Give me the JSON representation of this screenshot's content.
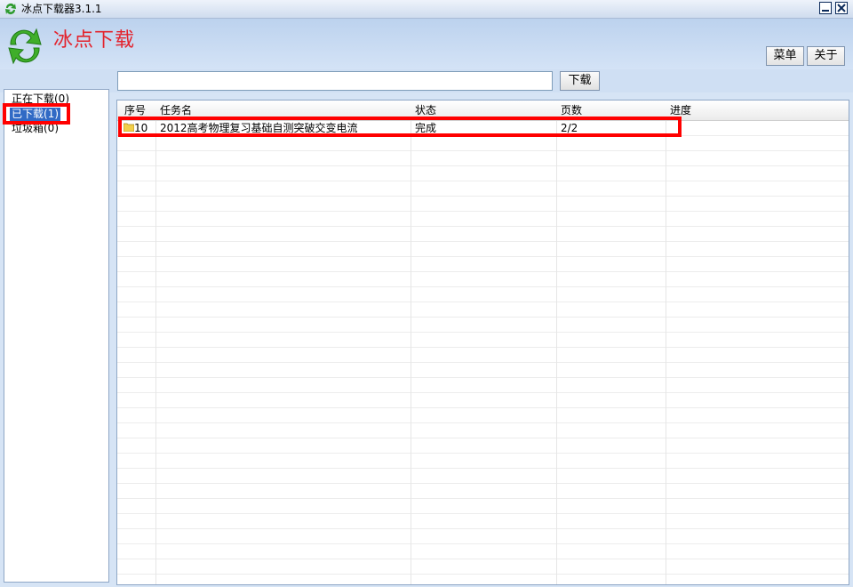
{
  "window": {
    "title": "冰点下载器3.1.1",
    "app_icon": "refresh-arrows-icon",
    "buttons": [
      "minimize-icon",
      "close-icon"
    ]
  },
  "header": {
    "brand": "冰点下载",
    "brand_color": "#e3232d",
    "logo_icon": "green-refresh-arrows-icon",
    "menu_label": "菜单",
    "about_label": "关于"
  },
  "toolbar": {
    "url_value": "",
    "download_label": "下载"
  },
  "sidebar": {
    "items": [
      {
        "label": "正在下载(0)",
        "selected": false
      },
      {
        "label": "已下载(1)",
        "selected": true
      },
      {
        "label": "垃圾箱(0)",
        "selected": false
      }
    ]
  },
  "table": {
    "columns": [
      "序号",
      "任务名",
      "状态",
      "页数",
      "进度"
    ],
    "rows": [
      {
        "seq": "10",
        "name": "2012高考物理复习基础自测突破交变电流",
        "status": "完成",
        "pages": "2/2",
        "progress": "",
        "icon": "folder-icon"
      }
    ]
  },
  "annotations": {
    "color": "#ff0000",
    "targets": [
      "downloaded-sidebar-item",
      "task-row-1"
    ]
  }
}
